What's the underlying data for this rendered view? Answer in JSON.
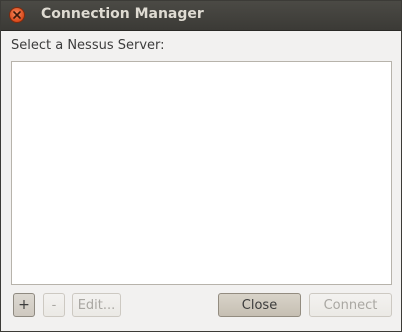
{
  "window": {
    "title": "Connection Manager"
  },
  "main": {
    "prompt_label": "Select a Nessus Server:",
    "servers": []
  },
  "toolbar": {
    "add_label": "+",
    "remove_label": "-",
    "edit_label": "Edit..."
  },
  "actions": {
    "close_label": "Close",
    "connect_label": "Connect"
  },
  "icons": {
    "window_close": "close-icon"
  },
  "colors": {
    "titlebar": "#3c3b37",
    "close_button": "#e0531f",
    "background": "#f2f1f0"
  }
}
